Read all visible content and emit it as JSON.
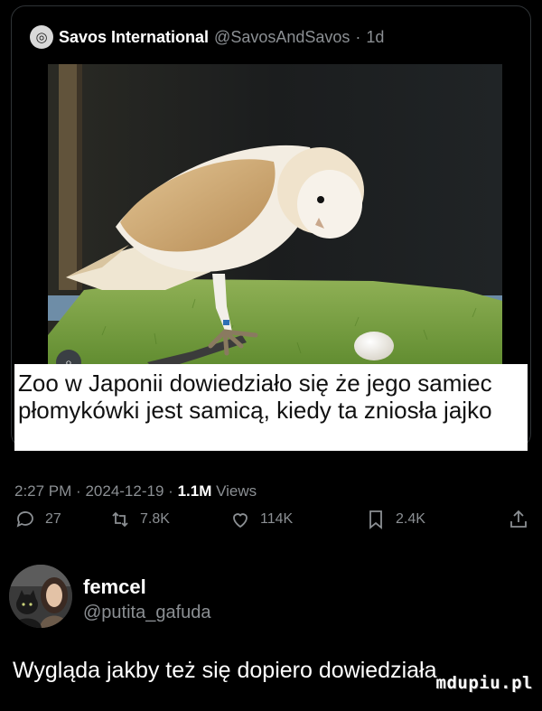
{
  "quoted_post": {
    "author_name": "Savos International",
    "author_handle": "@SavosAndSavos",
    "separator": "·",
    "age": "1d",
    "avatar_icon": "globe-icon",
    "media_badge_icon": "search-lens-icon",
    "caption": "Zoo w Japonii dowiedziało się że jego samiec płomykówki jest samicą, kiedy ta zniosła jajko"
  },
  "post_meta": {
    "time": "2:27 PM",
    "separator": "·",
    "date": "2024-12-19",
    "views": "1.1M",
    "views_label": "Views"
  },
  "actions": {
    "replies": "27",
    "reposts": "7.8K",
    "likes": "114K",
    "bookmarks": "2.4K",
    "icons": [
      "reply-icon",
      "repost-icon",
      "like-icon",
      "bookmark-icon",
      "share-icon"
    ]
  },
  "reply": {
    "name": "femcel",
    "handle": "@putita_gafuda",
    "text": "Wygląda jakby też się dopiero dowiedziała"
  },
  "watermark": "mdupiu.pl",
  "colors": {
    "background": "#000000",
    "muted_text": "#8b8f93",
    "primary_text": "#e7e9ea",
    "caption_bg": "#ffffff"
  }
}
